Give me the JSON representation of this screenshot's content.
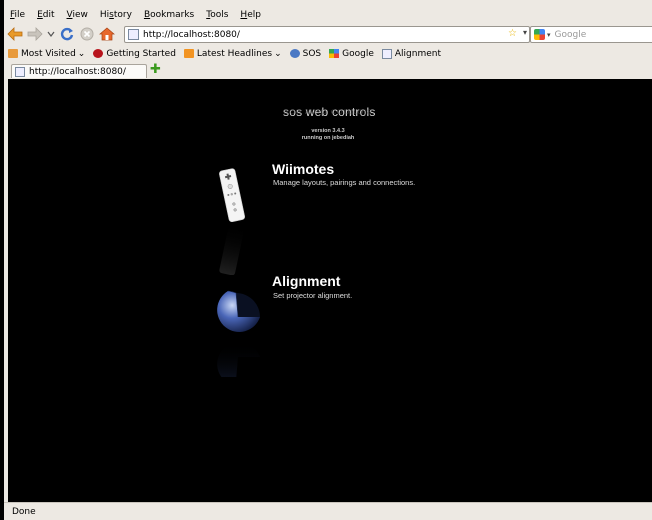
{
  "menubar": {
    "items": [
      "File",
      "Edit",
      "View",
      "History",
      "Bookmarks",
      "Tools",
      "Help"
    ],
    "mnemonics": [
      "F",
      "E",
      "V",
      "s",
      "B",
      "T",
      "H"
    ]
  },
  "navbar": {
    "url": "http://localhost:8080/",
    "search_placeholder": "Google"
  },
  "bookmarks": [
    {
      "label": "Most Visited",
      "icon": "folder-icon",
      "dropdown": true
    },
    {
      "label": "Getting Started",
      "icon": "firefox-icon",
      "dropdown": false
    },
    {
      "label": "Latest Headlines",
      "icon": "rss-icon",
      "dropdown": true
    },
    {
      "label": "SOS",
      "icon": "globe-icon",
      "dropdown": false
    },
    {
      "label": "Google",
      "icon": "google-icon",
      "dropdown": false
    },
    {
      "label": "Alignment",
      "icon": "page-icon",
      "dropdown": false
    }
  ],
  "tab": {
    "title": "http://localhost:8080/"
  },
  "page": {
    "logo_text": "sos web controls",
    "version_line1": "version 3.4.3",
    "version_line2": "running on jebediah",
    "sections": [
      {
        "title": "Wiimotes",
        "subtitle": "Manage layouts, pairings and connections."
      },
      {
        "title": "Alignment",
        "subtitle": "Set projector alignment."
      }
    ]
  },
  "status": {
    "text": "Done"
  },
  "colors": {
    "chrome": "#ede9e3",
    "content_bg": "#000000",
    "sphere_blue": "#4a66b8"
  }
}
